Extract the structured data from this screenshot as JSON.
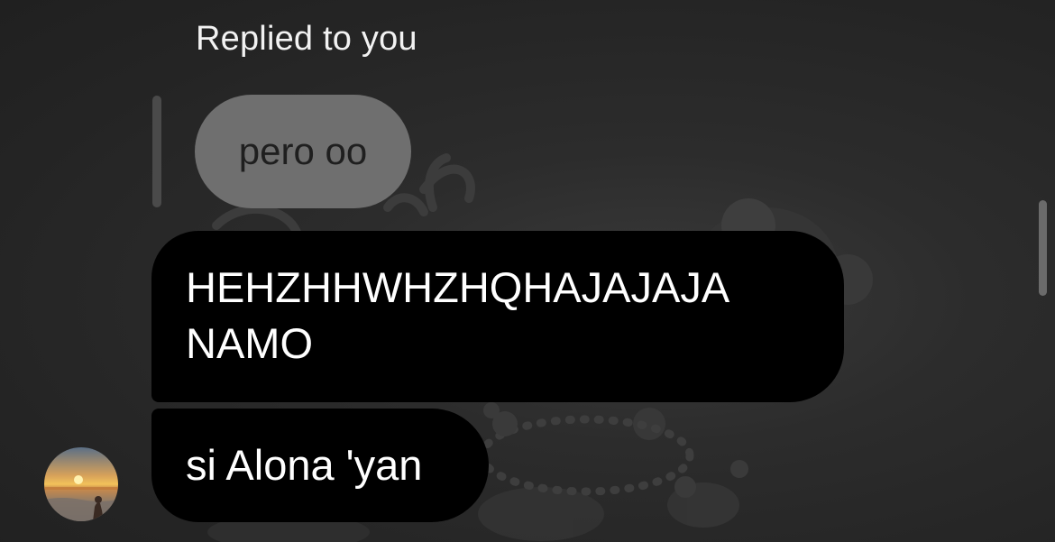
{
  "thread": {
    "reply_label": "Replied to you",
    "quoted_message": "pero oo",
    "messages": [
      {
        "text": "HEHZHHWHZHQHAJAJAJA NAMO"
      },
      {
        "text": "si Alona 'yan"
      }
    ],
    "sender": {
      "avatar_description": "sunset-over-sea-photo"
    }
  },
  "colors": {
    "background": "#262626",
    "bubble": "#000000",
    "bubble_text": "#ffffff",
    "quoted_bubble": "#6f6f6f",
    "quoted_text": "#1f1f1f",
    "reply_label": "#f2f2f2"
  }
}
